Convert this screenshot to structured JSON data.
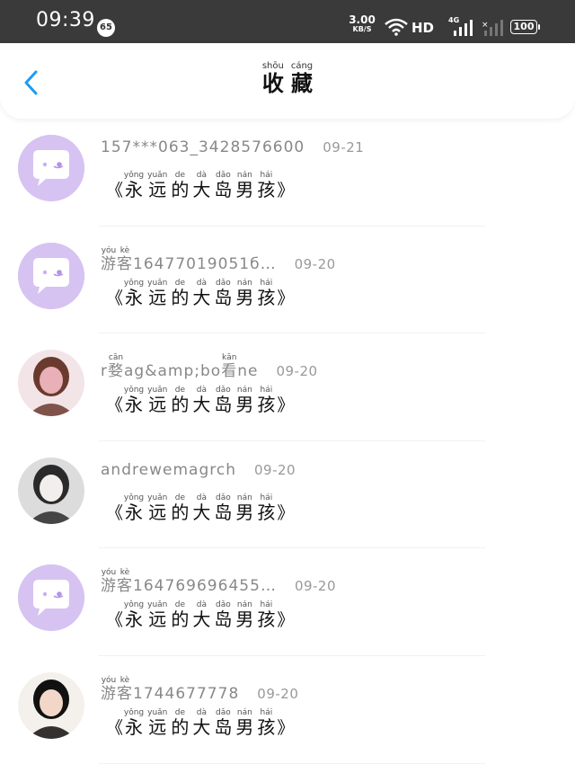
{
  "status_bar": {
    "time": "09:39",
    "badge": "65",
    "speed_value": "3.00",
    "speed_unit": "KB/S",
    "hd_label": "HD",
    "network_label": "4G",
    "battery": "100"
  },
  "header": {
    "back_icon": "chevron-left-icon",
    "title_chars": [
      {
        "char": "收",
        "pinyin": "shōu"
      },
      {
        "char": "藏",
        "pinyin": "cáng"
      }
    ],
    "accent_color": "#1e9bf0"
  },
  "book_title": {
    "open_quote": "《",
    "close_quote": "》",
    "chars": [
      {
        "char": "永",
        "pinyin": "yǒng"
      },
      {
        "char": "远",
        "pinyin": "yuǎn"
      },
      {
        "char": "的",
        "pinyin": "de"
      },
      {
        "char": "大",
        "pinyin": "dà"
      },
      {
        "char": "岛",
        "pinyin": "dǎo"
      },
      {
        "char": "男",
        "pinyin": "nán"
      },
      {
        "char": "孩",
        "pinyin": "hái"
      }
    ]
  },
  "items": [
    {
      "name_prefix": "",
      "name": "157***063_3428576600",
      "name_suffix": "",
      "date": "09-21",
      "avatar": "default-chat-avatar"
    },
    {
      "name_prefix": "游客",
      "name": "16477019051б…",
      "name_suffix": "",
      "date": "09-20",
      "avatar": "default-chat-avatar"
    },
    {
      "name_prefix": "",
      "name": "r婺ag&amp;bo",
      "name_suffix": "看ne",
      "date": "09-20",
      "avatar": "user-photo-avatar"
    },
    {
      "name_prefix": "",
      "name": "andrewemagrch",
      "name_suffix": "",
      "date": "09-20",
      "avatar": "user-photo-avatar"
    },
    {
      "name_prefix": "游客",
      "name": "164769696455…",
      "name_suffix": "",
      "date": "09-20",
      "avatar": "default-chat-avatar"
    },
    {
      "name_prefix": "游客",
      "name": "1744677778",
      "name_suffix": "",
      "date": "09-20",
      "avatar": "user-photo-avatar"
    }
  ],
  "name_ruby": {
    "游": "yóu",
    "客": "kè",
    "婺": "cān",
    "看": "kān"
  },
  "colors": {
    "default_avatar_bg": "#d6c3f2",
    "status_bar_bg": "#3a3a3a"
  }
}
